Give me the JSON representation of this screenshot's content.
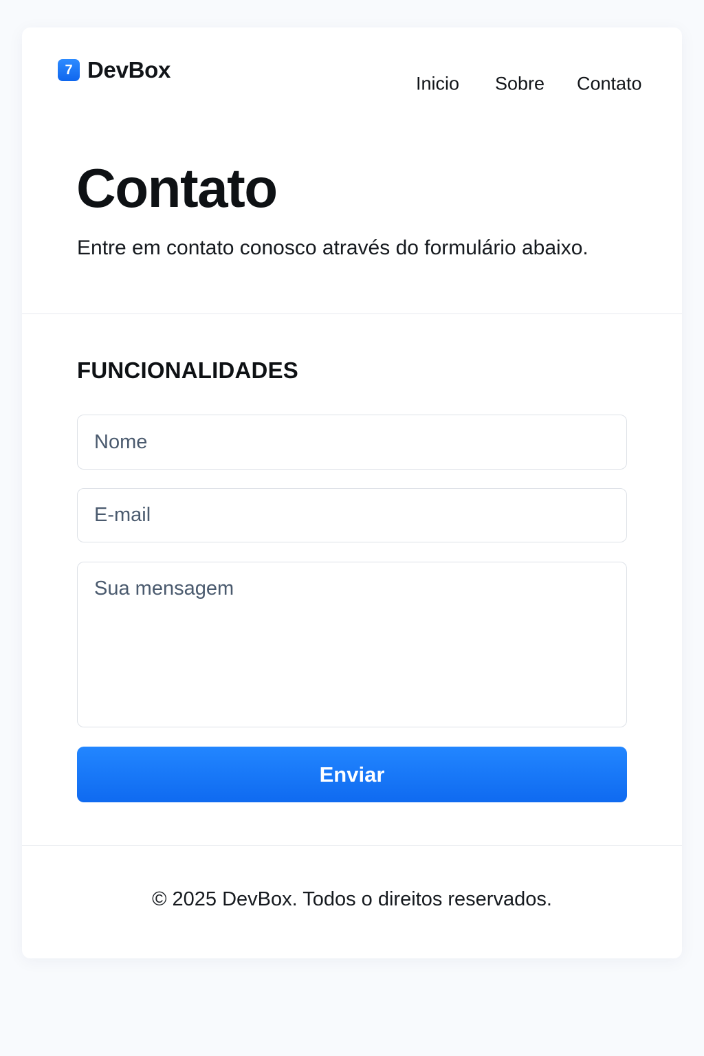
{
  "navbar": {
    "logo_glyph": "7",
    "brand": "DevBox",
    "links": [
      "Inicio",
      "Sobre",
      "Contato"
    ]
  },
  "hero": {
    "title": "Contato",
    "subtitle": "Entre em contato conosco através do formulário abaixo."
  },
  "form": {
    "section_title": "FUNCIONALIDADES",
    "name_placeholder": "Nome",
    "email_placeholder": "E-mail",
    "message_placeholder": "Sua mensagem",
    "submit_label": "Enviar"
  },
  "footer": {
    "text": "© 2025 DevBox. Todos o direitos reservados."
  },
  "colors": {
    "accent": "#1a7bfc",
    "text": "#111418",
    "placeholder": "#4a5a6e",
    "border": "#dde1e7"
  }
}
